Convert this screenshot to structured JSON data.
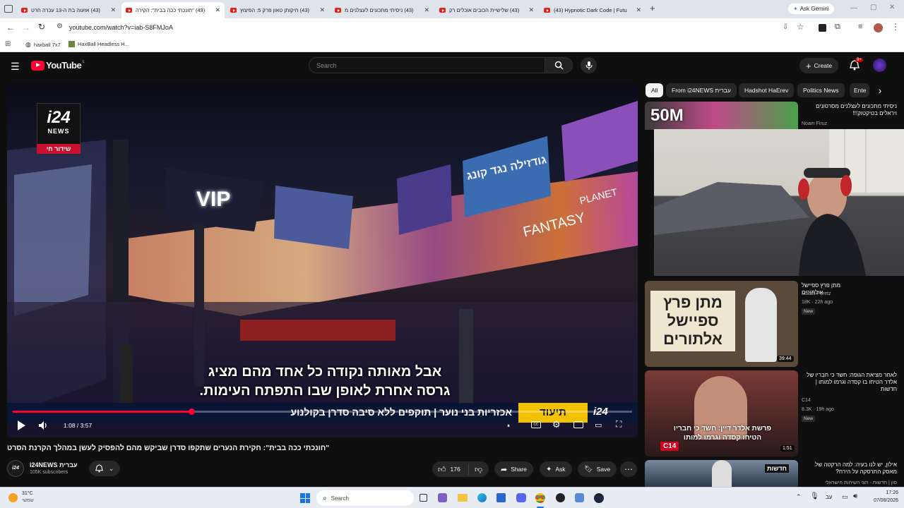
{
  "browser": {
    "tabs": [
      {
        "title": "(43) אזעוה בת ה-13 עכרה חרט",
        "active": false
      },
      {
        "title": "(43) \"חונכתי ככה בבית\": הקירה",
        "active": true
      },
      {
        "title": "(43) חיקותן טאון פרק 5: הפיצוץ",
        "active": false
      },
      {
        "title": "(43) ניסיתי מתכונים לעצלנים מ",
        "active": false
      },
      {
        "title": "(43) שלישיית הכובים אוכלים רק",
        "active": false
      },
      {
        "title": "(43) Hypnotic Dark Code | Futu",
        "active": false
      }
    ],
    "new_tab": "+",
    "ask_gemini": "Ask Gemini",
    "url": "youtube.com/watch?v=iab-S8FMJoA",
    "bookmarks": [
      "haxball 7x7",
      "HaxBall Headless H..."
    ]
  },
  "youtube": {
    "logo_text": "YouTube",
    "logo_region": "IL",
    "search_placeholder": "Search",
    "create_label": "Create",
    "notif_count": "9+",
    "chips": [
      "All",
      "From i24NEWS עברית",
      "Hadshot HaErev",
      "Politics News",
      "Ente"
    ]
  },
  "video": {
    "logo_top": "i24",
    "logo_bottom": "NEWS",
    "live_tag": "שידור חי",
    "subtitle_line1": "אבל מאותה נקודה כל אחד מהם מציג",
    "subtitle_line2": "גרסה אחרת לאופן שבו התפתח העימות.",
    "ticker_text": "אכזריות בני נוער | תוקפים ללא סיבה סדרן בקולנוע",
    "ticker_tag": "תיעוד",
    "ticker_logo": "i24",
    "time": "1:08 / 3:57",
    "progress": 0.289,
    "signs": [
      "VIP",
      "גודזילה נגד קונג",
      "PLANET",
      "FANTASY"
    ],
    "title": "\"חונכתי ככה בבית\": חקירת הנערים שתקפו סדרן שביקש מהם להפסיק לעשן במהלך הקרנת הסרט",
    "channel": "i24NEWS עברית",
    "subscribers": "105K subscribers",
    "likes": "176",
    "share": "Share",
    "ask": "Ask",
    "save": "Save"
  },
  "sidebar": [
    {
      "title": "ניסיתי מתכונים לעצלנים מסרטונים ויראלים בטיקטוק!!!",
      "channel": "Noam Firuz",
      "meta": "",
      "badge": "",
      "duration": "",
      "thumb_text": "50M"
    },
    {
      "title": "מתן פרץ ספיישל אילתורים",
      "channel": "Matan Peretz",
      "meta": "18K · 22h ago",
      "badge": "New",
      "duration": "39:44",
      "thumb_text": "מתן פרץ ספיישל אלתורים"
    },
    {
      "title": "לאחר מציאת הגופה: חשד כי חבריו של אלדר הטיחו בו קסדה וגרמו למותו | חדשות",
      "channel": "C14",
      "meta": "8.3K · 19h ago",
      "badge": "New",
      "duration": "1:51",
      "thumb_text": "פרשת אלדר דיין: חשד כי חבריו הטיחו קסדה וגרמו למותו"
    },
    {
      "title": "אילון, יש לנו בעיה: למה הרקטה של מאסק התרסקה על הירח?",
      "channel": "סון | חדשות - חצי השיחות הישראלי",
      "meta": "",
      "badge": "",
      "duration": "",
      "thumb_text": "חדשות"
    }
  ],
  "colors": {
    "accent": "#ff0033",
    "chip_bg": "#272727",
    "page_bg": "#0f0f0f"
  },
  "taskbar": {
    "weather_temp": "31°C",
    "weather_desc": "שמשי",
    "search": "Search",
    "lang": "עב",
    "time": "17:26",
    "date": "07/08/2026"
  }
}
